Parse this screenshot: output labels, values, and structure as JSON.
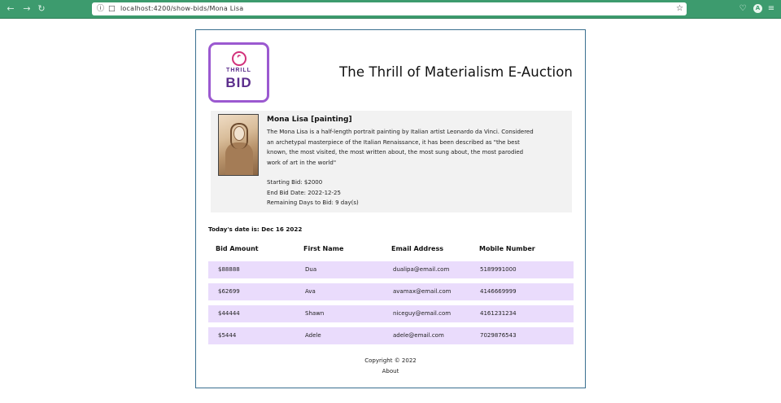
{
  "browser": {
    "back_icon": "arrow-left-icon",
    "forward_icon": "arrow-right-icon",
    "reload_icon": "reload-icon",
    "url": "localhost:4200/show-bids/Mona Lisa",
    "bookmark_icon": "star-icon",
    "profile_initial": "A"
  },
  "header": {
    "logo_line1": "THRILL",
    "logo_line2": "BID",
    "title": "The Thrill of Materialism E-Auction"
  },
  "item": {
    "title": "Mona Lisa [painting]",
    "description": "The Mona Lisa is a half-length portrait painting by Italian artist Leonardo da Vinci. Considered an archetypal masterpiece of the Italian Renaissance, it has been described as \"the best known, the most visited, the most written about, the most sung about, the most parodied work of art in the world\"",
    "starting_bid": "Starting Bid: $2000",
    "end_bid_date": "End Bid Date: 2022-12-25",
    "remaining_days": "Remaining Days to Bid: 9 day(s)"
  },
  "today": "Today's date is: Dec 16 2022",
  "table": {
    "columns": [
      "Bid Amount",
      "First Name",
      "Email Address",
      "Mobile Number"
    ],
    "rows": [
      [
        "$88888",
        "Dua",
        "dualipa@email.com",
        "5189991000"
      ],
      [
        "$62699",
        "Ava",
        "avamax@email.com",
        "4146669999"
      ],
      [
        "$44444",
        "Shawn",
        "niceguy@email.com",
        "4161231234"
      ],
      [
        "$5444",
        "Adele",
        "adele@email.com",
        "7029876543"
      ]
    ]
  },
  "footer": {
    "copyright": "Copyright © 2022",
    "about": "About"
  },
  "colors": {
    "chrome": "#3d9b6e",
    "logo_border": "#9b59d0",
    "row_bg": "#eadcfc",
    "card_bg": "#f2f2f2"
  }
}
